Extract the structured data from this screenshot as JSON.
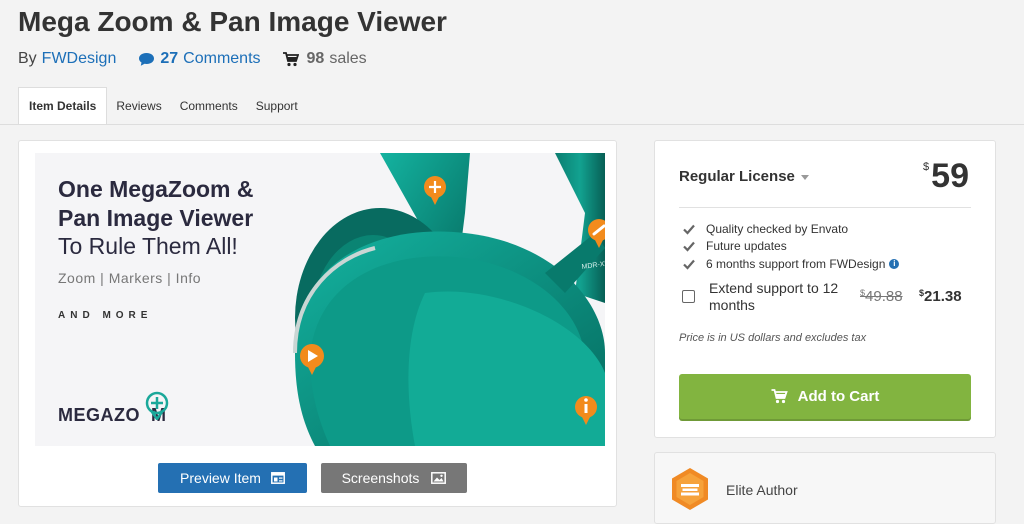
{
  "item": {
    "title": "Mega Zoom & Pan Image Viewer",
    "by_label": "By",
    "author": "FWDesign",
    "comments_count": "27",
    "comments_label": "Comments",
    "sales_count": "98",
    "sales_label": "sales"
  },
  "tabs": [
    {
      "label": "Item Details",
      "active": true
    },
    {
      "label": "Reviews"
    },
    {
      "label": "Comments"
    },
    {
      "label": "Support"
    }
  ],
  "banner": {
    "headline_line1": "One MegaZoom &",
    "headline_line2": "Pan Image Viewer",
    "tagline": "To Rule Them All!",
    "features": "Zoom  |  Markers  |  Info",
    "and_more": "AND MORE",
    "logo": "MEGAZO  M",
    "model_text": "MDR-XB"
  },
  "preview_actions": {
    "preview_label": "Preview Item",
    "screenshots_label": "Screenshots"
  },
  "license": {
    "name": "Regular License",
    "currency": "$",
    "price": "59",
    "features": [
      "Quality checked by Envato",
      "Future updates",
      "6 months support from FWDesign"
    ],
    "extend_label": "Extend support to 12 months",
    "extend_currency": "$",
    "old_price": "49.88",
    "new_price": "21.38",
    "tax_note": "Price is in US dollars and excludes tax",
    "cart_label": "Add to Cart"
  },
  "author_badge": {
    "label": "Elite Author"
  },
  "colors": {
    "link": "#1c6fb8",
    "preview_button": "#2470b3",
    "screenshots_button": "#777777",
    "cart_button": "#82b440",
    "headphone_teal": "#0a8f80",
    "marker_orange": "#f28b1c",
    "elite_badge": "#f08a24"
  }
}
